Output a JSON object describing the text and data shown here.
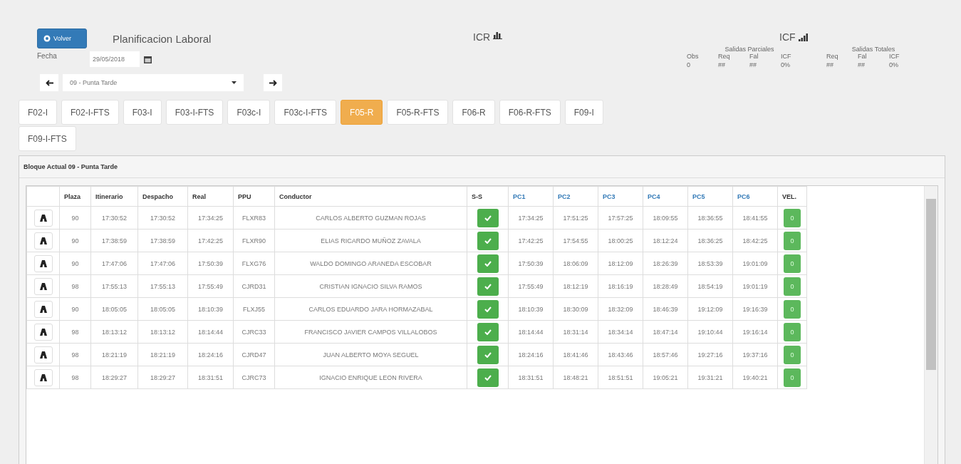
{
  "header": {
    "back_button": "Volver",
    "title": "Planificacion Laboral",
    "date_label": "Fecha",
    "date": "29/05/2018",
    "block_select": "09 - Punta Tarde"
  },
  "icr": {
    "title": "ICR"
  },
  "icf": {
    "title": "ICF",
    "groups": [
      {
        "title": "Salidas Parciales",
        "columns": [
          {
            "label": "Obs",
            "value": "0"
          },
          {
            "label": "Req",
            "value": "##"
          },
          {
            "label": "Fal",
            "value": "##"
          },
          {
            "label": "ICF",
            "value": "0%"
          }
        ]
      },
      {
        "title": "Salidas Totales",
        "columns": [
          {
            "label": "Req",
            "value": "##"
          },
          {
            "label": "Fal",
            "value": "##"
          },
          {
            "label": "ICF",
            "value": "0%"
          }
        ]
      }
    ]
  },
  "tabs": [
    {
      "label": "F02-I",
      "selected": false
    },
    {
      "label": "F02-I-FTS",
      "selected": false
    },
    {
      "label": "F03-I",
      "selected": false
    },
    {
      "label": "F03-I-FTS",
      "selected": false
    },
    {
      "label": "F03c-I",
      "selected": false
    },
    {
      "label": "F03c-I-FTS",
      "selected": false
    },
    {
      "label": "F05-R",
      "selected": true
    },
    {
      "label": "F05-R-FTS",
      "selected": false
    },
    {
      "label": "F06-R",
      "selected": false
    },
    {
      "label": "F06-R-FTS",
      "selected": false
    },
    {
      "label": "F09-I",
      "selected": false
    },
    {
      "label": "F09-I-FTS",
      "selected": false
    }
  ],
  "panel": {
    "title": "Bloque Actual 09 - Punta Tarde",
    "columns": [
      {
        "label": "Plaza",
        "link": false
      },
      {
        "label": "Itinerario",
        "link": false
      },
      {
        "label": "Despacho",
        "link": false
      },
      {
        "label": "Real",
        "link": false
      },
      {
        "label": "PPU",
        "link": false
      },
      {
        "label": "Conductor",
        "link": false
      },
      {
        "label": "S-S",
        "link": false
      },
      {
        "label": "PC1",
        "link": true
      },
      {
        "label": "PC2",
        "link": true
      },
      {
        "label": "PC3",
        "link": true
      },
      {
        "label": "PC4",
        "link": true
      },
      {
        "label": "PC5",
        "link": true
      },
      {
        "label": "PC6",
        "link": true
      },
      {
        "label": "VEL.",
        "link": false
      }
    ],
    "rows": [
      {
        "plaza": "90",
        "itinerario": "17:30:52",
        "despacho": "17:30:52",
        "real": "17:34:25",
        "ppu": "FLXR83",
        "conductor": "CARLOS ALBERTO GUZMAN ROJAS",
        "ss_checked": true,
        "pc": [
          "17:34:25",
          "17:51:25",
          "17:57:25",
          "18:09:55",
          "18:36:55",
          "18:41:55"
        ],
        "vel": "0"
      },
      {
        "plaza": "90",
        "itinerario": "17:38:59",
        "despacho": "17:38:59",
        "real": "17:42:25",
        "ppu": "FLXR90",
        "conductor": "ELIAS RICARDO MUÑOZ ZAVALA",
        "ss_checked": true,
        "pc": [
          "17:42:25",
          "17:54:55",
          "18:00:25",
          "18:12:24",
          "18:36:25",
          "18:42:25"
        ],
        "vel": "0"
      },
      {
        "plaza": "90",
        "itinerario": "17:47:06",
        "despacho": "17:47:06",
        "real": "17:50:39",
        "ppu": "FLXG76",
        "conductor": "WALDO DOMINGO ARANEDA ESCOBAR",
        "ss_checked": true,
        "pc": [
          "17:50:39",
          "18:06:09",
          "18:12:09",
          "18:26:39",
          "18:53:39",
          "19:01:09"
        ],
        "vel": "0"
      },
      {
        "plaza": "98",
        "itinerario": "17:55:13",
        "despacho": "17:55:13",
        "real": "17:55:49",
        "ppu": "CJRD31",
        "conductor": "CRISTIAN IGNACIO SILVA RAMOS",
        "ss_checked": true,
        "pc": [
          "17:55:49",
          "18:12:19",
          "18:16:19",
          "18:28:49",
          "18:54:19",
          "19:01:19"
        ],
        "vel": "0"
      },
      {
        "plaza": "90",
        "itinerario": "18:05:05",
        "despacho": "18:05:05",
        "real": "18:10:39",
        "ppu": "FLXJ55",
        "conductor": "CARLOS EDUARDO JARA HORMAZABAL",
        "ss_checked": true,
        "pc": [
          "18:10:39",
          "18:30:09",
          "18:32:09",
          "18:46:39",
          "19:12:09",
          "19:16:39"
        ],
        "vel": "0"
      },
      {
        "plaza": "98",
        "itinerario": "18:13:12",
        "despacho": "18:13:12",
        "real": "18:14:44",
        "ppu": "CJRC33",
        "conductor": "FRANCISCO JAVIER CAMPOS VILLALOBOS",
        "ss_checked": true,
        "pc": [
          "18:14:44",
          "18:31:14",
          "18:34:14",
          "18:47:14",
          "19:10:44",
          "19:16:14"
        ],
        "vel": "0"
      },
      {
        "plaza": "98",
        "itinerario": "18:21:19",
        "despacho": "18:21:19",
        "real": "18:24:16",
        "ppu": "CJRD47",
        "conductor": "JUAN ALBERTO MOYA SEGUEL",
        "ss_checked": true,
        "pc": [
          "18:24:16",
          "18:41:46",
          "18:43:46",
          "18:57:46",
          "19:27:16",
          "19:37:16"
        ],
        "vel": "0"
      },
      {
        "plaza": "98",
        "itinerario": "18:29:27",
        "despacho": "18:29:27",
        "real": "18:31:51",
        "ppu": "CJRC73",
        "conductor": "IGNACIO ENRIQUE LEON RIVERA",
        "ss_checked": true,
        "pc": [
          "18:31:51",
          "18:48:21",
          "18:51:51",
          "19:05:21",
          "19:31:21",
          "19:40:21"
        ],
        "vel": "0"
      }
    ]
  }
}
